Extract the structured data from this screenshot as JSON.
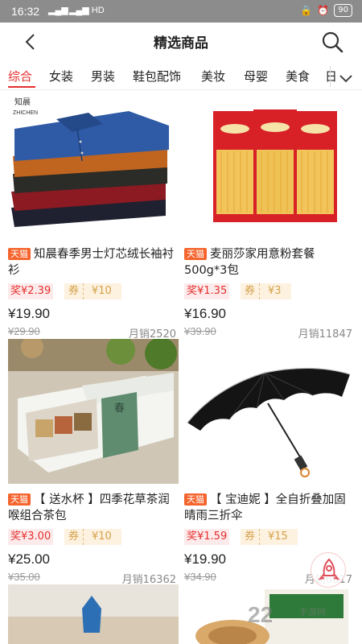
{
  "status_bar": {
    "time": "16:32",
    "signal1": "5G",
    "signal2": "HD",
    "battery": "90"
  },
  "header": {
    "title": "精选商品"
  },
  "tabs": [
    "综合",
    "女装",
    "男装",
    "鞋包配饰",
    "美妆",
    "母婴",
    "美食",
    "日"
  ],
  "colors": {
    "accent": "#e62e2e",
    "tmall_badge": "#f5642d",
    "coupon_bg": "#fdf1e0"
  },
  "products": [
    {
      "badge": "天猫",
      "title": "知晨春季男士灯芯绒长袖衬衫",
      "rebate": "奖¥2.39",
      "coupon_label": "券",
      "coupon_value": "¥10",
      "price": "¥19.90",
      "original_price": "¥29.90",
      "sales": "月销2520",
      "image_brand": "知晨",
      "image_brand_sub": "ZHICHEN",
      "image": "stacked-corduroy-shirts"
    },
    {
      "badge": "天猫",
      "title": "麦丽莎家用意粉套餐500g*3包",
      "rebate": "奖¥1.35",
      "coupon_label": "券",
      "coupon_value": "¥3",
      "price": "¥16.90",
      "original_price": "¥39.90",
      "sales": "月销11847",
      "image": "spaghetti-packs"
    },
    {
      "badge": "天猫",
      "title": "【 送水杯 】四季花草茶润喉组合茶包",
      "rebate": "奖¥3.00",
      "coupon_label": "券",
      "coupon_value": "¥10",
      "price": "¥25.00",
      "original_price": "¥35.00",
      "sales": "月销16362",
      "image": "herbal-tea-gift-box"
    },
    {
      "badge": "天猫",
      "title": "【 宝迪妮 】全自折叠加固晴雨三折伞",
      "rebate": "奖¥1.59",
      "coupon_label": "券",
      "coupon_value": "¥15",
      "price": "¥19.90",
      "original_price": "¥34.90",
      "sales": "月销6617",
      "image": "black-umbrella"
    }
  ],
  "watermark": {
    "text": "22",
    "sub": "手游网"
  }
}
